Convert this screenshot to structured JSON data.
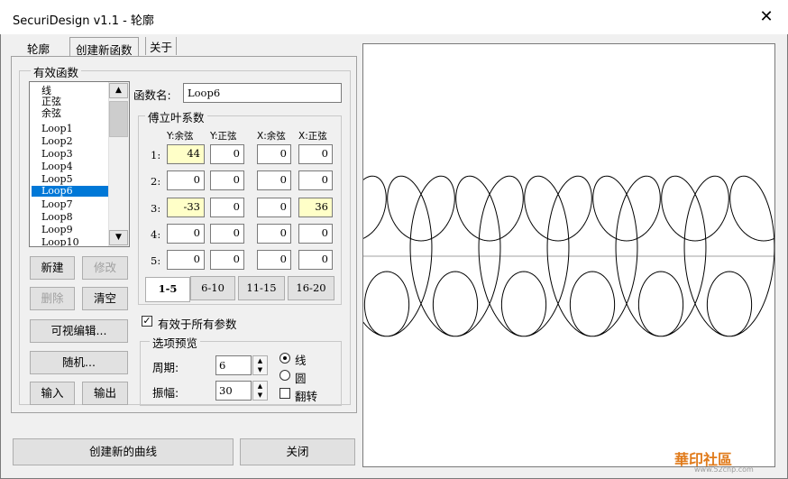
{
  "window": {
    "title": "SecuriDesign v1.1 - 轮廓"
  },
  "tabs": [
    "轮廓",
    "创建新函数",
    "关于"
  ],
  "func_group": {
    "label": "有效函数"
  },
  "functions": [
    "线",
    "正弦",
    "余弦",
    "Loop1",
    "Loop2",
    "Loop3",
    "Loop4",
    "Loop5",
    "Loop6",
    "Loop7",
    "Loop8",
    "Loop9",
    "Loop10"
  ],
  "selected_function": "Loop6",
  "name_field": {
    "label": "函数名:",
    "value": "Loop6"
  },
  "fourier": {
    "label": "傅立叶系数",
    "columns": [
      "Y:余弦",
      "Y:正弦",
      "X:余弦",
      "X:正弦"
    ],
    "rows": [
      {
        "label": "1:",
        "values": [
          "44",
          "0",
          "0",
          "0"
        ]
      },
      {
        "label": "2:",
        "values": [
          "0",
          "0",
          "0",
          "0"
        ]
      },
      {
        "label": "3:",
        "values": [
          "-33",
          "0",
          "0",
          "36"
        ]
      },
      {
        "label": "4:",
        "values": [
          "0",
          "0",
          "0",
          "0"
        ]
      },
      {
        "label": "5:",
        "values": [
          "0",
          "0",
          "0",
          "0"
        ]
      }
    ],
    "range_tabs": [
      "1-5",
      "6-10",
      "11-15",
      "16-20"
    ]
  },
  "buttons": {
    "new": "新建",
    "edit": "修改",
    "delete": "删除",
    "clear": "清空",
    "visual_edit": "可视编辑...",
    "random": "随机...",
    "import": "输入",
    "export": "输出",
    "create_curve": "创建新的曲线",
    "close": "关闭"
  },
  "apply_all": {
    "label": "有效于所有参数",
    "checked": true
  },
  "preview_opts": {
    "label": "选项预览",
    "period_label": "周期:",
    "period_value": "6",
    "amp_label": "振幅:",
    "amp_value": "30",
    "radio_line": "线",
    "radio_circle": "圆",
    "flip": "翻转"
  },
  "watermark": {
    "text": "華印社區",
    "url": "www.52cnp.com"
  },
  "colors": {
    "selection": "#0078d7",
    "highlight_cell": "#ffffc8"
  }
}
